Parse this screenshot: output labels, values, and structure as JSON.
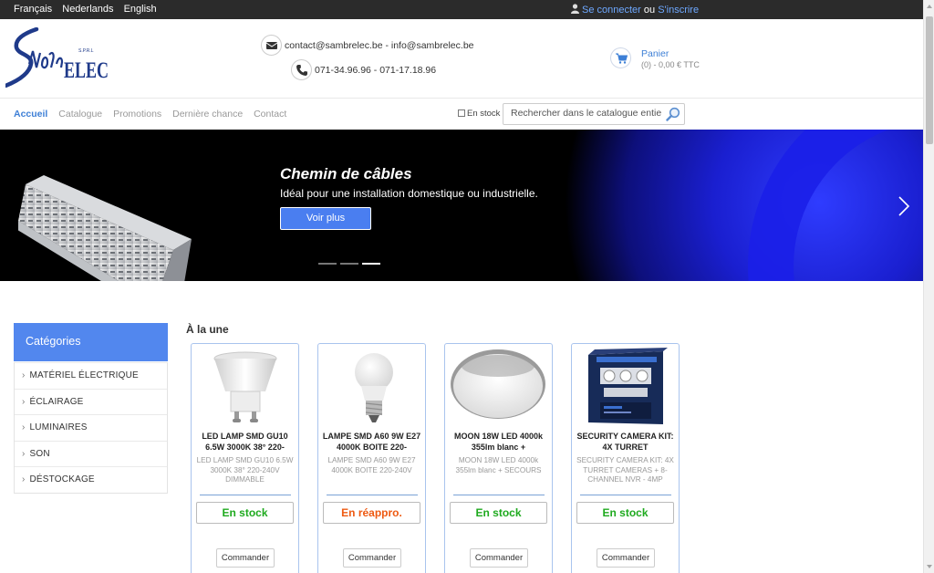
{
  "topbar": {
    "languages": [
      "Français",
      "Nederlands",
      "English"
    ],
    "login": "Se connecter",
    "or": "ou",
    "register": "S'inscrire"
  },
  "header": {
    "email": "contact@sambrelec.be - info@sambrelec.be",
    "phone": "071-34.96.96 - 071-17.18.96",
    "cart_title": "Panier",
    "cart_summary": "(0) - 0,00 € TTC"
  },
  "nav": {
    "items": [
      "Accueil",
      "Catalogue",
      "Promotions",
      "Dernière chance",
      "Contact"
    ],
    "instock_label": "En stock",
    "search_placeholder": "Rechercher dans le catalogue entier"
  },
  "banner": {
    "title": "Chemin de câbles",
    "subtitle": "Idéal pour une installation domestique ou industrielle.",
    "cta": "Voir plus"
  },
  "categories": {
    "title": "Catégories",
    "items": [
      "MATÉRIEL ÉLECTRIQUE",
      "ÉCLAIRAGE",
      "LUMINAIRES",
      "SON",
      "DÉSTOCKAGE"
    ]
  },
  "featured": {
    "title": "À la une",
    "products": [
      {
        "name": "LED LAMP SMD GU10 6.5W 3000K 38° 220-",
        "desc": "LED LAMP SMD GU10 6.5W 3000K 38° 220-240V DIMMABLE",
        "stock": "En stock",
        "order": "Commander"
      },
      {
        "name": "LAMPE SMD A60 9W E27 4000K BOITE 220-",
        "desc": "LAMPE SMD A60 9W E27 4000K BOITE 220-240V",
        "stock": "En réappro.",
        "order": "Commander"
      },
      {
        "name": "MOON 18W LED 4000k 355lm blanc +",
        "desc": "MOON 18W LED 4000k 355lm blanc + SECOURS",
        "stock": "En stock",
        "order": "Commander"
      },
      {
        "name": "SECURITY CAMERA KIT: 4X TURRET",
        "desc": "SECURITY CAMERA KIT: 4X TURRET CAMERAS + 8-CHANNEL NVR - 4MP",
        "stock": "En stock",
        "order": "Commander"
      }
    ]
  },
  "colors": {
    "accent": "#3d7fd6",
    "category_header": "#5287ee",
    "in_stock": "#1faa1f",
    "restock": "#ee5a12",
    "topbar": "#2b2b2b"
  }
}
